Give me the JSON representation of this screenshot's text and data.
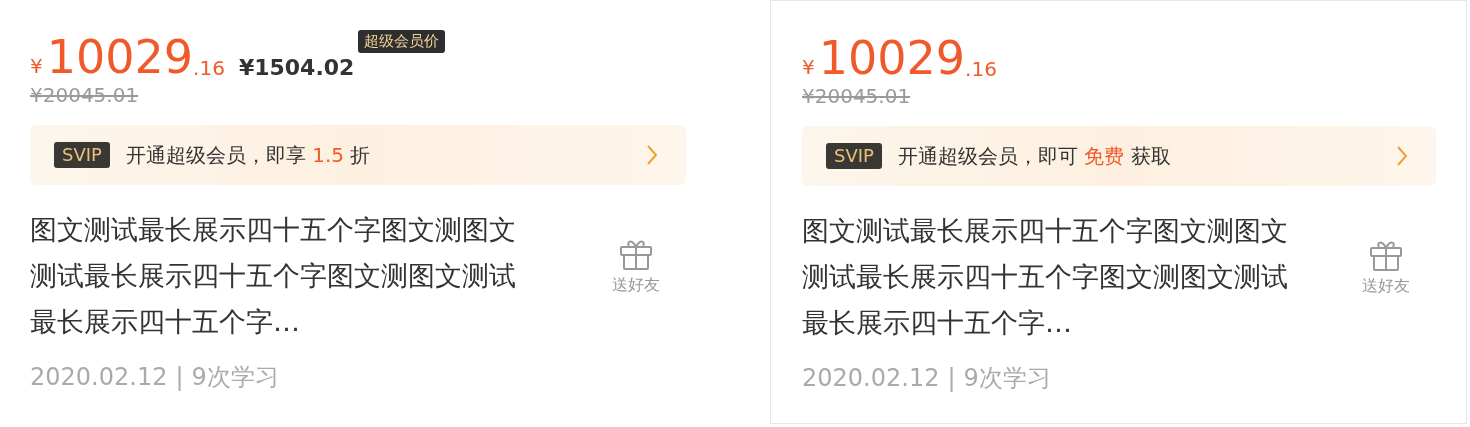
{
  "cards": [
    {
      "bordered": false,
      "price": {
        "currency": "¥",
        "integer": "10029",
        "decimal": ".16",
        "member_price": "¥1504.02",
        "member_badge": "超级会员价",
        "original": "¥20045.01"
      },
      "banner": {
        "badge": "SVIP",
        "prefix": "开通超级会员，即享",
        "highlight": "1.5",
        "suffix": "折"
      },
      "title_lines": [
        "图文测试最长展示四十五个字图文测图文",
        "测试最长展示四十五个字图文测图文测试",
        "最长展示四十五个字…"
      ],
      "gift_label": "送好友",
      "date": "2020.02.12",
      "separator": "|",
      "study_count": "9次学习"
    },
    {
      "bordered": true,
      "price": {
        "currency": "¥",
        "integer": "10029",
        "decimal": ".16",
        "original": "¥20045.01"
      },
      "banner": {
        "badge": "SVIP",
        "prefix": "开通超级会员，即可",
        "highlight": "免费",
        "suffix": "获取"
      },
      "title_lines": [
        "图文测试最长展示四十五个字图文测图文",
        "测试最长展示四十五个字图文测图文测试",
        "最长展示四十五个字…"
      ],
      "gift_label": "送好友",
      "date": "2020.02.12",
      "separator": "|",
      "study_count": "9次学习"
    }
  ]
}
